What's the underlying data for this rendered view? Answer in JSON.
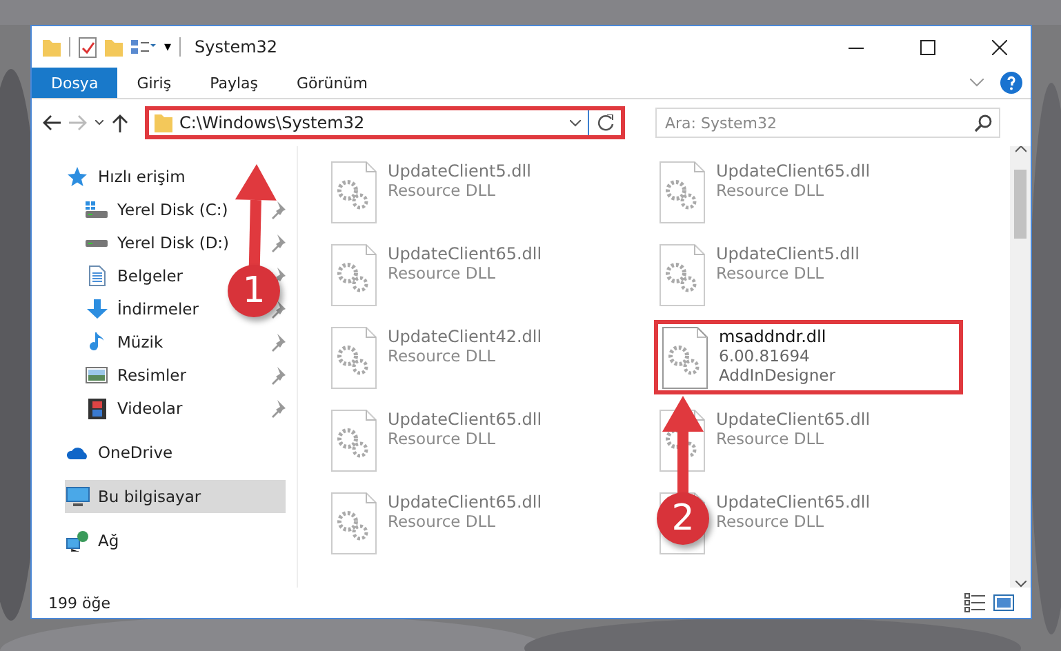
{
  "window": {
    "title": "System32",
    "quick_access_dropdown": "▾"
  },
  "ribbon_tabs": [
    {
      "label": "Dosya",
      "selected": true
    },
    {
      "label": "Giriş",
      "selected": false
    },
    {
      "label": "Paylaş",
      "selected": false
    },
    {
      "label": "Görünüm",
      "selected": false
    }
  ],
  "address_bar": {
    "path": "C:\\Windows\\System32",
    "highlighted": true
  },
  "search": {
    "placeholder": "Ara: System32"
  },
  "sidebar": {
    "items": [
      {
        "label": "Hızlı erişim",
        "pinned": false,
        "selected": false,
        "children": [
          {
            "label": "Yerel Disk (C:)",
            "pinned": true,
            "selected": false
          },
          {
            "label": "Yerel Disk (D:)",
            "pinned": true,
            "selected": false
          },
          {
            "label": "Belgeler",
            "pinned": true,
            "selected": false
          },
          {
            "label": "İndirmeler",
            "pinned": true,
            "selected": false
          },
          {
            "label": "Müzik",
            "pinned": true,
            "selected": false
          },
          {
            "label": "Resimler",
            "pinned": true,
            "selected": false
          },
          {
            "label": "Videolar",
            "pinned": true,
            "selected": false
          }
        ]
      },
      {
        "label": "OneDrive",
        "pinned": false,
        "selected": false
      },
      {
        "label": "Bu bilgisayar",
        "pinned": false,
        "selected": true
      },
      {
        "label": "Ağ",
        "pinned": false,
        "selected": false
      }
    ]
  },
  "files": [
    {
      "name": "UpdateClient5.dll",
      "detail": [
        "Resource DLL"
      ],
      "highlighted": false
    },
    {
      "name": "UpdateClient65.dll",
      "detail": [
        "Resource DLL"
      ],
      "highlighted": false
    },
    {
      "name": "UpdateClient65.dll",
      "detail": [
        "Resource DLL"
      ],
      "highlighted": false
    },
    {
      "name": "UpdateClient5.dll",
      "detail": [
        "Resource DLL"
      ],
      "highlighted": false
    },
    {
      "name": "UpdateClient42.dll",
      "detail": [
        "Resource DLL"
      ],
      "highlighted": false
    },
    {
      "name": "msaddndr.dll",
      "detail": [
        "6.00.81694",
        "AddInDesigner"
      ],
      "highlighted": true
    },
    {
      "name": "UpdateClient65.dll",
      "detail": [
        "Resource DLL"
      ],
      "highlighted": false
    },
    {
      "name": "UpdateClient65.dll",
      "detail": [
        "Resource DLL"
      ],
      "highlighted": false
    },
    {
      "name": "UpdateClient65.dll",
      "detail": [
        "Resource DLL"
      ],
      "highlighted": false
    },
    {
      "name": "UpdateClient65.dll",
      "detail": [
        "Resource DLL"
      ],
      "highlighted": false
    }
  ],
  "status_bar": {
    "item_count": "199 öğe"
  },
  "callouts": [
    {
      "number": "1"
    },
    {
      "number": "2"
    }
  ]
}
